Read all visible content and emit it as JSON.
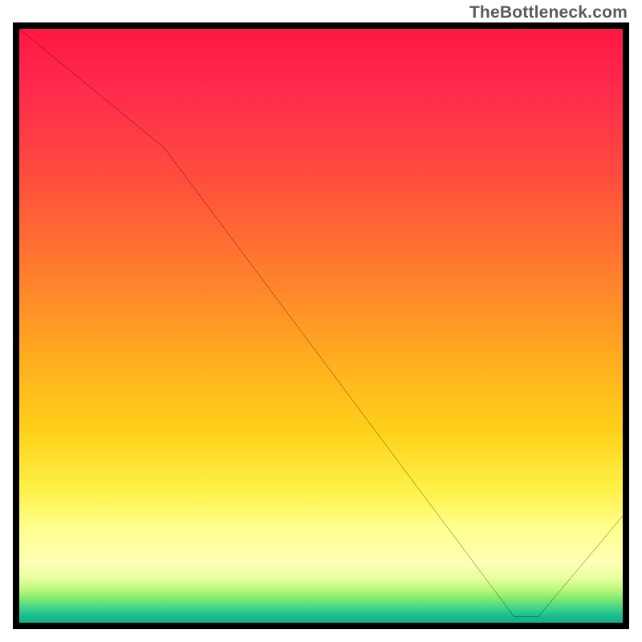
{
  "watermark": "TheBottleneck.com",
  "colors": {
    "border": "#000000",
    "line": "#000000",
    "marker_text": "#b74038"
  },
  "chart_data": {
    "type": "line",
    "title": "",
    "xlabel": "",
    "ylabel": "",
    "xlim": [
      0,
      100
    ],
    "ylim": [
      0,
      100
    ],
    "grid": false,
    "legend": false,
    "series": [
      {
        "name": "curve",
        "x": [
          0,
          24,
          82,
          86,
          100
        ],
        "values": [
          100,
          80,
          1,
          1,
          18
        ]
      }
    ],
    "annotations": [
      {
        "text": "",
        "x": 78.5,
        "y": 1.7
      }
    ],
    "background_gradient_stops": [
      {
        "pos": 0.0,
        "color": "#ff1744"
      },
      {
        "pos": 0.4,
        "color": "#ff7a2e"
      },
      {
        "pos": 0.78,
        "color": "#fff24a"
      },
      {
        "pos": 0.92,
        "color": "#e8ffa0"
      },
      {
        "pos": 1.0,
        "color": "#0fb18c"
      }
    ]
  }
}
